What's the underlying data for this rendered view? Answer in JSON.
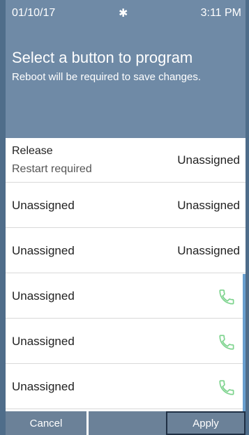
{
  "status": {
    "date": "01/10/17",
    "bluetooth_icon": "bluetooth-icon",
    "time": "3:11 PM"
  },
  "header": {
    "title": "Select a button to program",
    "subtitle": "Reboot will be required to save changes."
  },
  "rows": [
    {
      "left": "Release",
      "left_sub": "Restart required",
      "right": "Unassigned"
    },
    {
      "left": "Unassigned",
      "right": "Unassigned"
    },
    {
      "left": "Unassigned",
      "right": "Unassigned"
    },
    {
      "left": "Unassigned",
      "right_icon": "phone-icon"
    },
    {
      "left": "Unassigned",
      "right_icon": "phone-icon"
    },
    {
      "left": "Unassigned",
      "right_icon": "phone-icon"
    }
  ],
  "footer": {
    "cancel_label": "Cancel",
    "middle_label": "",
    "apply_label": "Apply"
  },
  "colors": {
    "header_bg": "#6f8aa6",
    "button_bg": "#6b8198",
    "accent_phone": "#7fd48f",
    "scrollbar": "#6aa0d0"
  }
}
